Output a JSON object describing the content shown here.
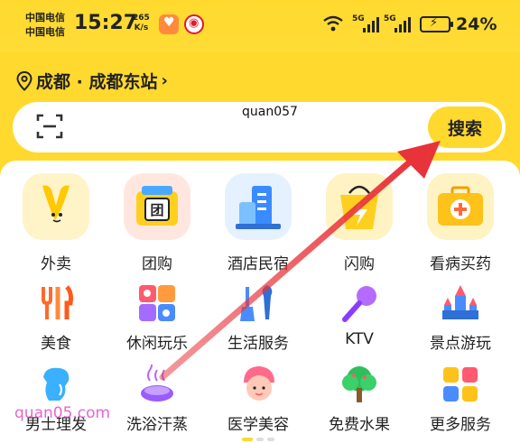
{
  "status_bar": {
    "carrier_1": "中国电信",
    "carrier_2": "中国电信",
    "time": "15:27",
    "net_speed_value": "265",
    "net_speed_unit": "K/s",
    "signal_1_label": "5G",
    "signal_2_label": "5G",
    "battery_percent": "24%"
  },
  "location": {
    "text": "成都 · 成都东站",
    "chevron": "›"
  },
  "search": {
    "button_label": "搜索",
    "scan_icon": "scan-icon"
  },
  "watermarks": {
    "top": "quan057",
    "bottom": "quan05.com"
  },
  "grid_row_1": [
    {
      "label": "外卖",
      "icon": "takeout-icon"
    },
    {
      "label": "团购",
      "icon": "group-buy-icon"
    },
    {
      "label": "酒店民宿",
      "icon": "hotel-icon"
    },
    {
      "label": "闪购",
      "icon": "flash-buy-icon"
    },
    {
      "label": "看病买药",
      "icon": "medicine-icon"
    }
  ],
  "grid_row_2": [
    {
      "label": "美食",
      "icon": "food-icon"
    },
    {
      "label": "休闲玩乐",
      "icon": "leisure-icon"
    },
    {
      "label": "生活服务",
      "icon": "life-service-icon"
    },
    {
      "label": "KTV",
      "icon": "ktv-icon"
    },
    {
      "label": "景点游玩",
      "icon": "scenic-icon"
    }
  ],
  "grid_row_3": [
    {
      "label": "男士理发",
      "icon": "haircut-icon"
    },
    {
      "label": "洗浴汗蒸",
      "icon": "bath-icon"
    },
    {
      "label": "医学美容",
      "icon": "beauty-icon"
    },
    {
      "label": "免费水果",
      "icon": "fruit-icon"
    },
    {
      "label": "更多服务",
      "icon": "more-icon"
    }
  ],
  "colors": {
    "brand_yellow": "#ffd92e",
    "arrow_red": "#e8333a"
  }
}
